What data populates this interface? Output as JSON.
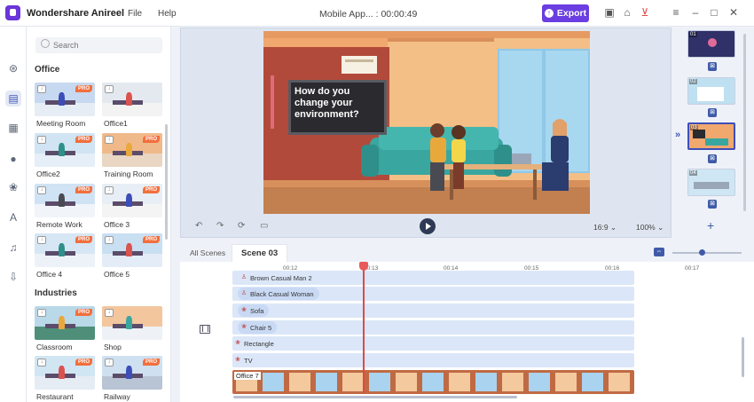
{
  "app": {
    "name": "Wondershare Anireel",
    "doc_title": "Mobile App... : 00:00:49"
  },
  "menu": {
    "file": "File",
    "help": "Help"
  },
  "toolbar": {
    "export_label": "Export"
  },
  "colors": {
    "accent": "#6a3ee0",
    "pro_badge": "#f26f3d",
    "playhead": "#e04848"
  },
  "search": {
    "placeholder": "Search"
  },
  "panel": {
    "section_office": "Office",
    "section_industries": "Industries",
    "pro_label": "PRO",
    "items": [
      {
        "label": "Meeting Room",
        "pro": true
      },
      {
        "label": "Office1",
        "pro": false
      },
      {
        "label": "Office2",
        "pro": true
      },
      {
        "label": "Training Room",
        "pro": true
      },
      {
        "label": "Remote Work",
        "pro": true
      },
      {
        "label": "Office 3",
        "pro": true
      },
      {
        "label": "Office 4",
        "pro": true
      },
      {
        "label": "Office 5",
        "pro": true
      },
      {
        "label": "Classroom",
        "pro": true
      },
      {
        "label": "Shop",
        "pro": false
      },
      {
        "label": "Restaurant",
        "pro": true
      },
      {
        "label": "Railway",
        "pro": true
      }
    ]
  },
  "stage": {
    "board_text": "How do you change your environment?"
  },
  "playback": {
    "ratio": "16:9",
    "zoom": "100%"
  },
  "scenes": [
    {
      "num": "01"
    },
    {
      "num": "02"
    },
    {
      "num": "03"
    },
    {
      "num": "04"
    }
  ],
  "timeline": {
    "tab_all": "All Scenes",
    "tab_active": "Scene 03",
    "ticks": [
      "00:12",
      "00:13",
      "00:14",
      "00:15",
      "00:16",
      "00:17"
    ],
    "tracks": [
      "Brown Casual Man 2",
      "Black Casual Woman",
      "Sofa",
      "Chair 5",
      "Rectangle",
      "TV"
    ],
    "background_track": "Office 7"
  }
}
